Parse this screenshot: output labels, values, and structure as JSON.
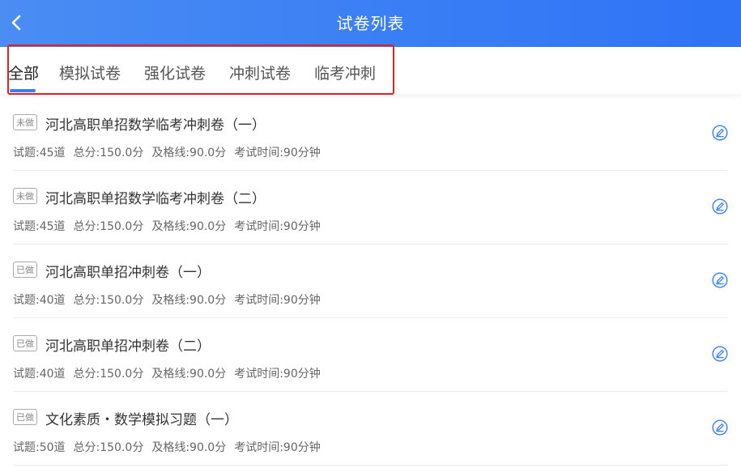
{
  "header": {
    "title": "试卷列表"
  },
  "tabs": [
    {
      "label": "全部"
    },
    {
      "label": "模拟试卷"
    },
    {
      "label": "强化试卷"
    },
    {
      "label": "冲刺试卷"
    },
    {
      "label": "临考冲刺"
    }
  ],
  "papers": [
    {
      "status": "未做",
      "title": "河北高职单招数学临考冲刺卷（一）",
      "questions": "试题:45道",
      "total": "总分:150.0分",
      "pass": "及格线:90.0分",
      "time": "考试时间:90分钟"
    },
    {
      "status": "未做",
      "title": "河北高职单招数学临考冲刺卷（二）",
      "questions": "试题:45道",
      "total": "总分:150.0分",
      "pass": "及格线:90.0分",
      "time": "考试时间:90分钟"
    },
    {
      "status": "已做",
      "title": "河北高职单招冲刺卷（一）",
      "questions": "试题:40道",
      "total": "总分:150.0分",
      "pass": "及格线:90.0分",
      "time": "考试时间:90分钟"
    },
    {
      "status": "已做",
      "title": "河北高职单招冲刺卷（二）",
      "questions": "试题:40道",
      "total": "总分:150.0分",
      "pass": "及格线:90.0分",
      "time": "考试时间:90分钟"
    },
    {
      "status": "已做",
      "title": "文化素质・数学模拟习题（一）",
      "questions": "试题:50道",
      "total": "总分:150.0分",
      "pass": "及格线:90.0分",
      "time": "考试时间:90分钟"
    }
  ],
  "colors": {
    "primary": "#3a7ef5",
    "highlight": "#e02020"
  },
  "icons": {
    "back": "chevron-left-icon",
    "edit": "edit-pen-icon"
  }
}
